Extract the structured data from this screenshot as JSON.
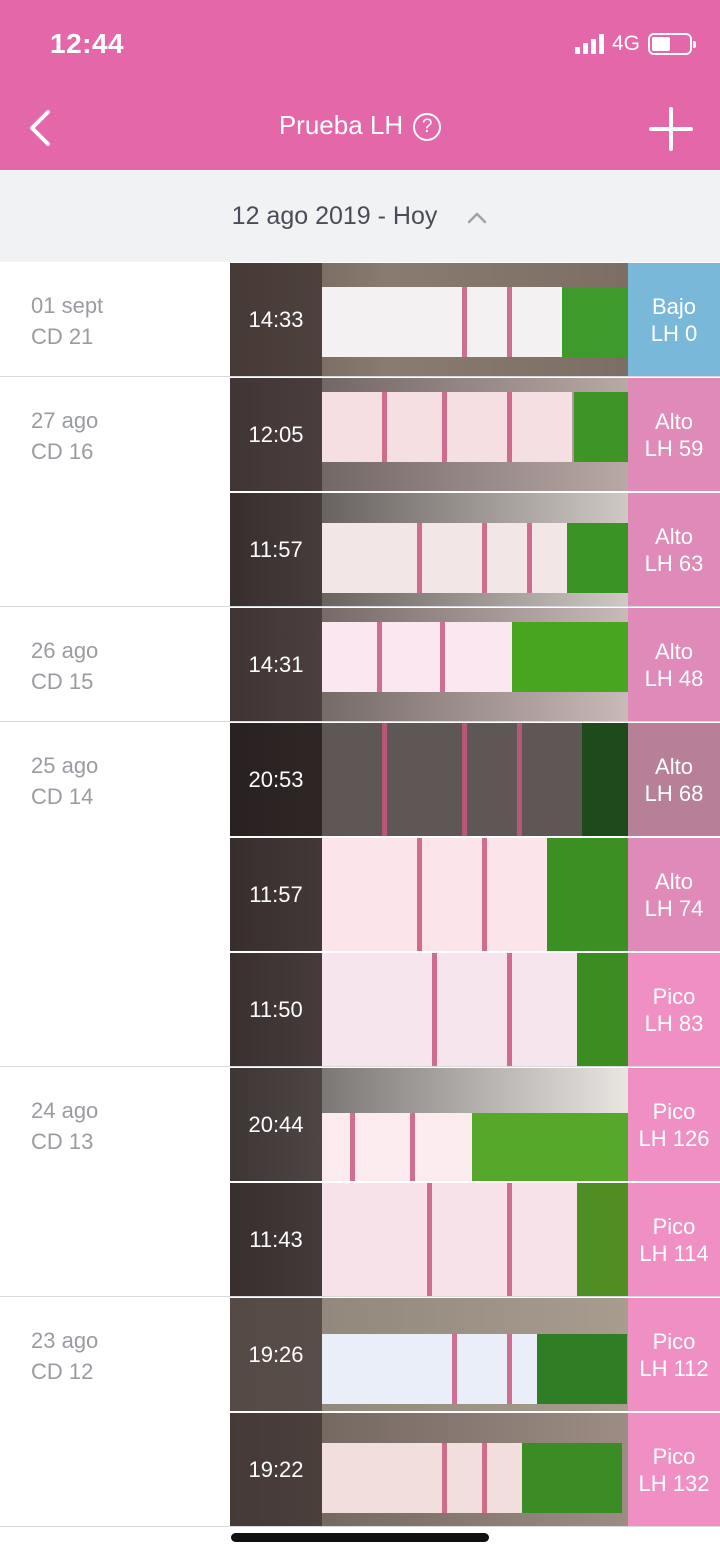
{
  "status_bar": {
    "time": "12:44",
    "network": "4G"
  },
  "nav": {
    "title": "Prueba LH",
    "help": "?"
  },
  "range": {
    "label": "12 ago 2019 - Hoy"
  },
  "colors": {
    "accent": "#e467a9",
    "bajo": "#7ab8da",
    "alto": "#df8ab8",
    "pico": "#f08fc4"
  },
  "groups": [
    {
      "date": "01 sept",
      "cd": "CD 21",
      "tests": [
        {
          "time": "14:33",
          "level": "Bajo",
          "lh": "LH 0",
          "color": "#7ab8da"
        }
      ]
    },
    {
      "date": "27 ago",
      "cd": "CD 16",
      "tests": [
        {
          "time": "12:05",
          "level": "Alto",
          "lh": "LH 59",
          "color": "#df8ab8"
        },
        {
          "time": "11:57",
          "level": "Alto",
          "lh": "LH 63",
          "color": "#df8ab8"
        }
      ]
    },
    {
      "date": "26 ago",
      "cd": "CD 15",
      "tests": [
        {
          "time": "14:31",
          "level": "Alto",
          "lh": "LH 48",
          "color": "#df8ab8"
        }
      ]
    },
    {
      "date": "25 ago",
      "cd": "CD 14",
      "tests": [
        {
          "time": "20:53",
          "level": "Alto",
          "lh": "LH 68",
          "color": "#b88098"
        },
        {
          "time": "11:57",
          "level": "Alto",
          "lh": "LH 74",
          "color": "#df8ab8"
        },
        {
          "time": "11:50",
          "level": "Pico",
          "lh": "LH 83",
          "color": "#f08fc4"
        }
      ]
    },
    {
      "date": "24 ago",
      "cd": "CD 13",
      "tests": [
        {
          "time": "20:44",
          "level": "Pico",
          "lh": "LH 126",
          "color": "#f08fc4"
        },
        {
          "time": "11:43",
          "level": "Pico",
          "lh": "LH 114",
          "color": "#f08fc4"
        }
      ]
    },
    {
      "date": "23 ago",
      "cd": "CD 12",
      "tests": [
        {
          "time": "19:26",
          "level": "Pico",
          "lh": "LH 112",
          "color": "#f08fc4"
        },
        {
          "time": "19:22",
          "level": "Pico",
          "lh": "LH 132",
          "color": "#f08fc4"
        }
      ]
    }
  ]
}
